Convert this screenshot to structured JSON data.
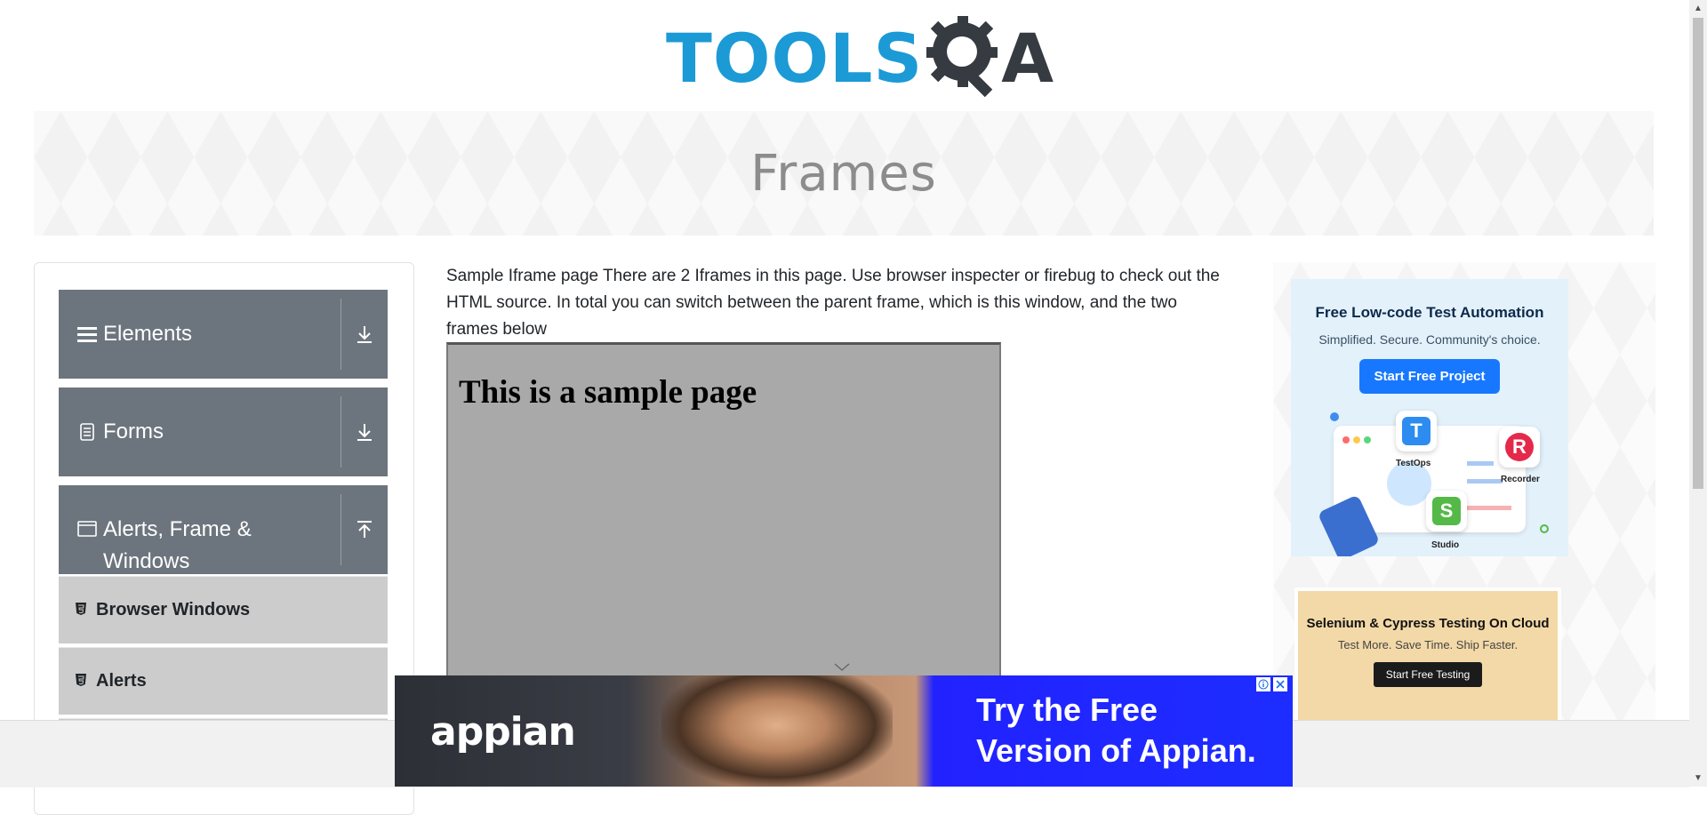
{
  "header": {
    "logo_tools": "TOOLS",
    "logo_a": "A"
  },
  "banner": {
    "title": "Frames"
  },
  "sidebar": {
    "groups": [
      {
        "label": "Elements",
        "icon": "hamburger-icon",
        "toggle": "download-icon"
      },
      {
        "label": "Forms",
        "icon": "document-icon",
        "toggle": "download-icon"
      },
      {
        "label": "Alerts, Frame & Windows",
        "icon": "window-icon",
        "toggle": "upload-icon"
      }
    ],
    "sub_items": [
      {
        "label": "Browser Windows",
        "icon": "html5-icon"
      },
      {
        "label": "Alerts",
        "icon": "html5-icon"
      }
    ]
  },
  "main": {
    "description": "Sample Iframe page There are 2 Iframes in this page. Use browser inspecter or firebug to check out the HTML source. In total you can switch between the parent frame, which is this window, and the two frames below",
    "iframe_heading": "This is a sample page"
  },
  "ads": {
    "ad1": {
      "title": "Free Low-code Test Automation",
      "subtitle": "Simplified. Secure. Community's choice.",
      "button": "Start Free Project",
      "products": [
        "TestOps",
        "Recorder",
        "Studio"
      ],
      "product_letters": [
        "T",
        "R",
        "S"
      ]
    },
    "ad2": {
      "title": "Selenium & Cypress Testing On Cloud",
      "subtitle": "Test More. Save Time. Ship Faster.",
      "button": "Start Free Testing"
    },
    "bottom": {
      "brand": "appian",
      "slogan_line1": "Try the Free",
      "slogan_line2": "Version of Appian."
    }
  },
  "colors": {
    "logo_blue": "#1b9ad6",
    "logo_dark": "#353b41",
    "sidebar_group": "#6c757d",
    "sidebar_sub": "#cccccc",
    "ad_button_blue": "#1778ff",
    "appian_blue": "#2222ff"
  }
}
